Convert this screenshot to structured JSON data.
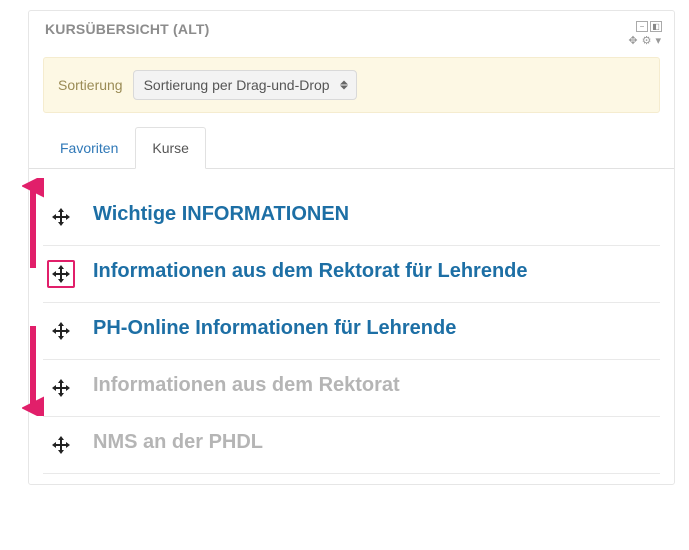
{
  "panel": {
    "title": "KURSÜBERSICHT (ALT)"
  },
  "sort": {
    "label": "Sortierung",
    "selected": "Sortierung per Drag-und-Drop"
  },
  "tabs": [
    {
      "label": "Favoriten",
      "active": false
    },
    {
      "label": "Kurse",
      "active": true
    }
  ],
  "courses": [
    {
      "title": "Wichtige INFORMATIONEN",
      "muted": false,
      "highlight": false
    },
    {
      "title": "Informationen aus dem Rektorat für Lehrende",
      "muted": false,
      "highlight": true
    },
    {
      "title": "PH-Online Informationen für Lehrende",
      "muted": false,
      "highlight": false
    },
    {
      "title": "Informationen aus dem Rektorat",
      "muted": true,
      "highlight": false
    },
    {
      "title": "NMS an der PHDL",
      "muted": true,
      "highlight": false
    }
  ],
  "colors": {
    "link": "#1d6fa5",
    "muted": "#b5b5b5",
    "accentPink": "#e11f6a"
  }
}
